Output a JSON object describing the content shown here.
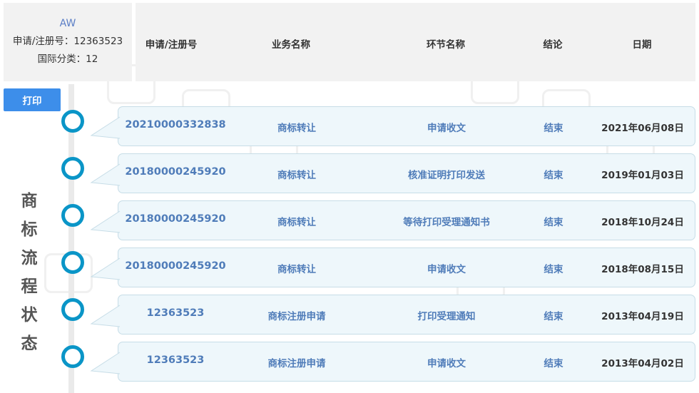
{
  "info": {
    "brand": "AW",
    "reg_no_line": "申请/注册号：12363523",
    "class_line": "国际分类：12"
  },
  "header": {
    "reg_no": "申请/注册号",
    "business": "业务名称",
    "step": "环节名称",
    "result": "结论",
    "date": "日期"
  },
  "print_label": "打印",
  "vertical_title": [
    "商",
    "标",
    "流",
    "程",
    "状",
    "态"
  ],
  "steps": [
    {
      "reg_no": "20210000332838",
      "business": "商标转让",
      "step": "申请收文",
      "result": "结束",
      "date": "2021年06月08日"
    },
    {
      "reg_no": "20180000245920",
      "business": "商标转让",
      "step": "核准证明打印发送",
      "result": "结束",
      "date": "2019年01月03日"
    },
    {
      "reg_no": "20180000245920",
      "business": "商标转让",
      "step": "等待打印受理通知书",
      "result": "结束",
      "date": "2018年10月24日"
    },
    {
      "reg_no": "20180000245920",
      "business": "商标转让",
      "step": "申请收文",
      "result": "结束",
      "date": "2018年08月15日"
    },
    {
      "reg_no": "12363523",
      "business": "商标注册申请",
      "step": "打印受理通知",
      "result": "结束",
      "date": "2013年04月19日"
    },
    {
      "reg_no": "12363523",
      "business": "商标注册申请",
      "step": "申请收文",
      "result": "结束",
      "date": "2013年04月02日"
    }
  ],
  "colors": {
    "accent": "#3d8eea",
    "dot": "#0a95c7",
    "card_bg": "#eef7fb",
    "link_text": "#4f7cb9"
  }
}
